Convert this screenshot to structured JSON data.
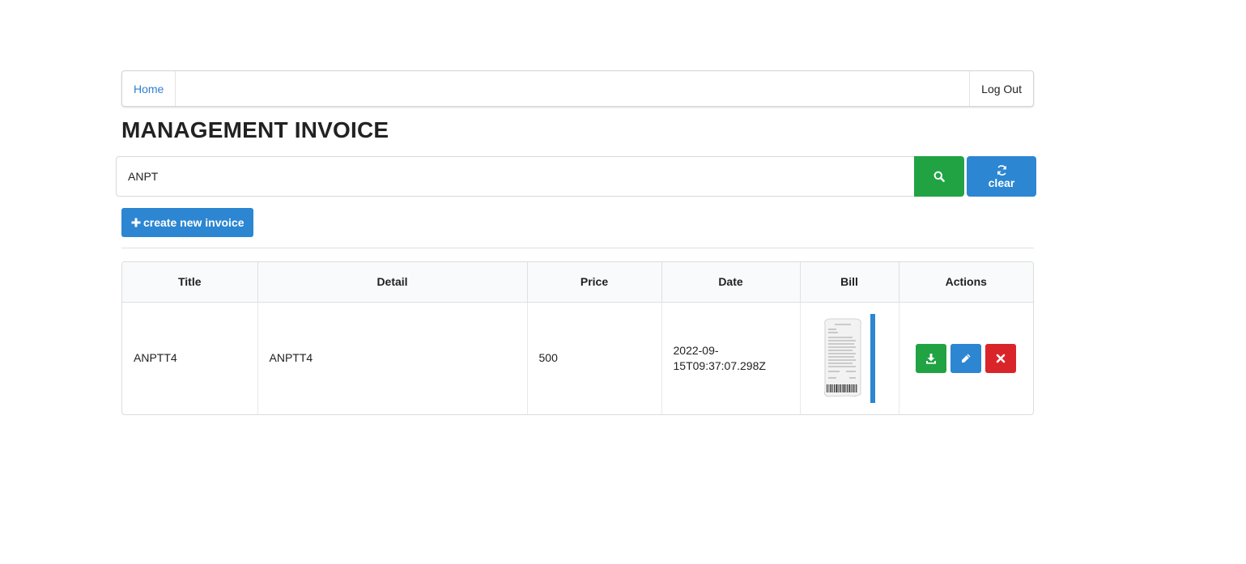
{
  "nav": {
    "home_label": "Home",
    "logout_label": "Log Out"
  },
  "page": {
    "title": "MANAGEMENT INVOICE"
  },
  "search": {
    "value": "ANPT",
    "clear_label": "clear",
    "search_icon": "search-icon",
    "clear_icon": "refresh-icon"
  },
  "create": {
    "label": "create new invoice",
    "icon": "plus-icon"
  },
  "table": {
    "headers": [
      "Title",
      "Detail",
      "Price",
      "Date",
      "Bill",
      "Actions"
    ],
    "rows": [
      {
        "title": "ANPTT4",
        "detail": "ANPTT4",
        "price": "500",
        "date": "2022-09-15T09:37:07.298Z",
        "bill": "receipt-thumbnail"
      }
    ]
  },
  "colors": {
    "primary": "#2c86d2",
    "success": "#21a344",
    "danger": "#d9252a",
    "link": "#2f7fd0"
  }
}
